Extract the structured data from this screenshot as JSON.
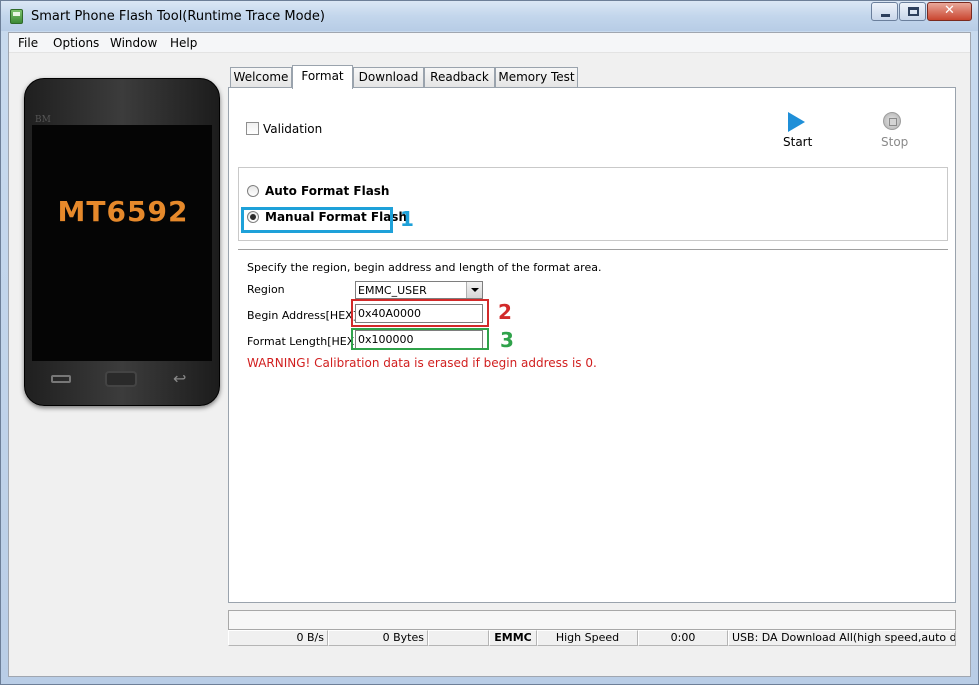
{
  "window": {
    "title": "Smart Phone Flash Tool(Runtime Trace Mode)",
    "controls": [
      "minimize",
      "maximize",
      "close"
    ]
  },
  "menu": [
    "File",
    "Options",
    "Window",
    "Help"
  ],
  "phone": {
    "brand_mark": "BM",
    "chip_label": "MT6592",
    "accent_color": "#e6892b"
  },
  "tabs": [
    {
      "label": "Welcome",
      "active": false
    },
    {
      "label": "Format",
      "active": true
    },
    {
      "label": "Download",
      "active": false
    },
    {
      "label": "Readback",
      "active": false
    },
    {
      "label": "Memory Test",
      "active": false
    }
  ],
  "format": {
    "validation_label": "Validation",
    "validation_checked": false,
    "start_label": "Start",
    "stop_label": "Stop",
    "stop_enabled": false,
    "auto_format_label": "Auto Format Flash",
    "manual_format_label": "Manual Format Flash",
    "selected_mode": "manual",
    "description": "Specify the region, begin address and length of the format area.",
    "region_label": "Region",
    "region_value": "EMMC_USER",
    "begin_address_label": "Begin Address[HEX]:",
    "begin_address_value": "0x40A0000",
    "format_length_label": "Format Length[HEX]:",
    "format_length_value": "0x100000",
    "warning": "WARNING! Calibration data is erased if begin address is 0."
  },
  "annotations": {
    "marker_1": "1",
    "marker_2": "2",
    "marker_3": "3",
    "colors": {
      "marker_1": "#1ea1d9",
      "marker_2": "#d22a2a",
      "marker_3": "#2fa24a"
    }
  },
  "statusbar": {
    "speed": "0 B/s",
    "bytes": "0 Bytes",
    "empty": "",
    "storage": "EMMC",
    "mode": "High Speed",
    "time": "0:00",
    "usb": "USB: DA Download All(high speed,auto detect)"
  }
}
